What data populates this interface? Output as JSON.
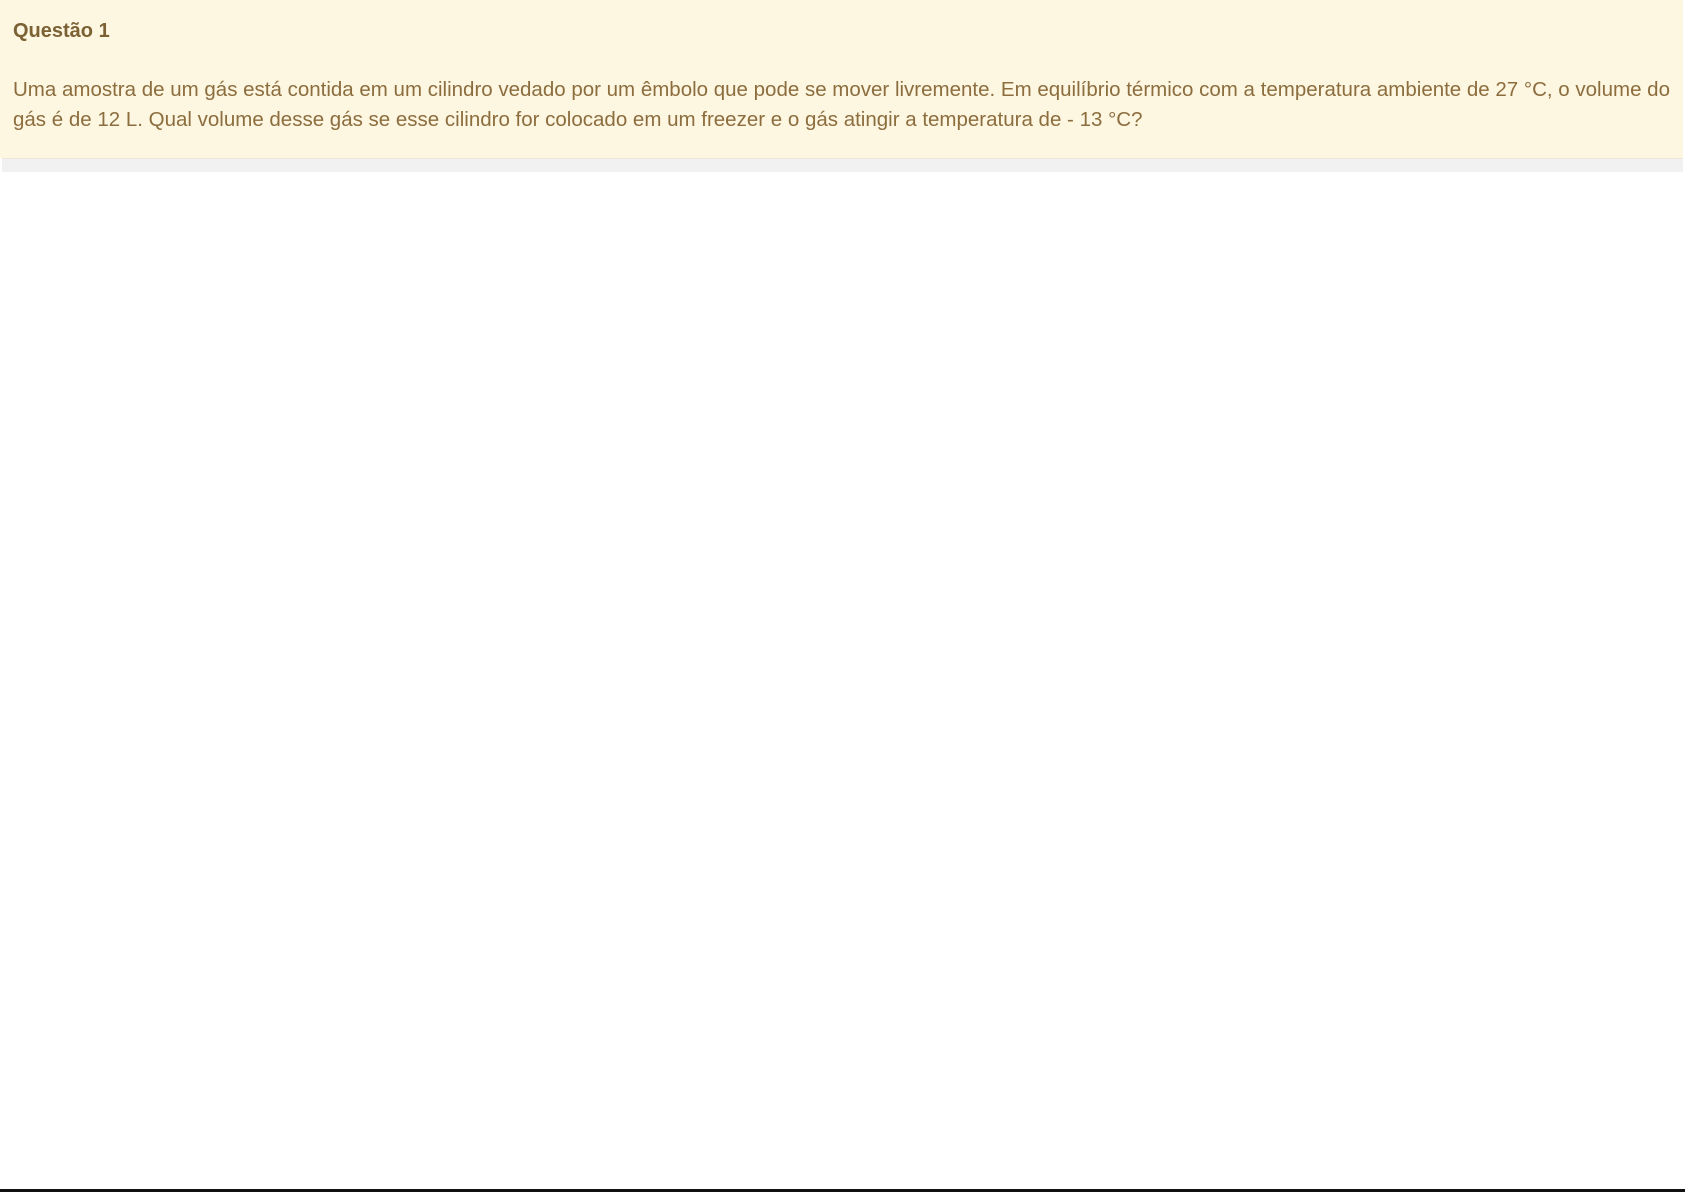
{
  "question": {
    "title": "Questão 1",
    "text": "Uma amostra de um gás está contida em um cilindro vedado por um êmbolo que pode se mover livremente. Em equilíbrio térmico com a temperatura ambiente de 27 °C, o volume do gás é de 12 L. Qual volume desse gás se esse cilindro for colocado em um freezer e o gás atingir a temperatura de - 13 °C?"
  },
  "colors": {
    "panel_background": "#fdf6e1",
    "title_text": "#7b6134",
    "body_text": "#8c6d3e",
    "footer_bar": "#f1f1f1"
  }
}
